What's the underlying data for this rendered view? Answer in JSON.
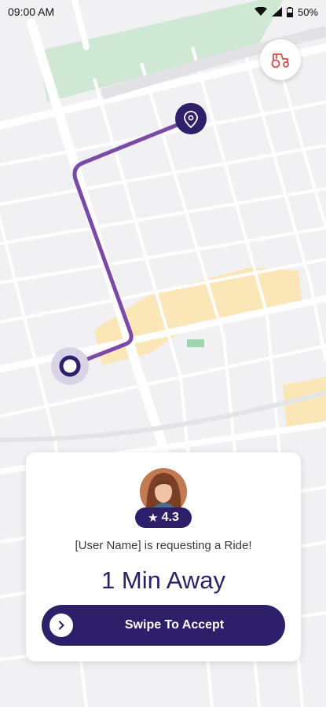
{
  "status_bar": {
    "time": "09:00 AM",
    "battery": "50%"
  },
  "map": {
    "route_color": "#7b4aa8",
    "park_color": "#cfe8d4",
    "building_color": "#fbe6b8"
  },
  "fab": {
    "icon": "tractor-icon",
    "accent": "#d94b4b"
  },
  "card": {
    "rating": "4.3",
    "request_text": "[User Name] is requesting a Ride!",
    "eta": "1 Min Away",
    "swipe_label": "Swipe To Accept"
  },
  "colors": {
    "primary": "#2e1f6b"
  }
}
